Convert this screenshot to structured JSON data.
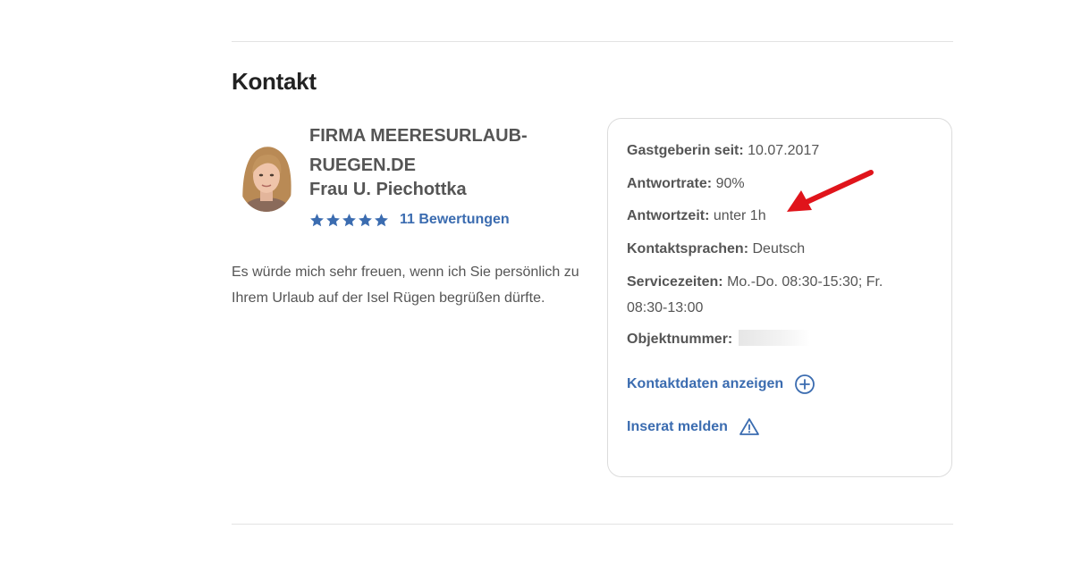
{
  "section": {
    "title": "Kontakt"
  },
  "host": {
    "company": "FIRMA MEERESURLAUB-RUEGEN.DE",
    "name": "Frau U. Piechottka",
    "rating_stars": 5,
    "reviews_link": "11 Bewertungen",
    "intro": "Es würde mich sehr freuen, wenn ich Sie persönlich zu Ihrem Urlaub auf der Isel Rügen begrüßen dürfte."
  },
  "facts": {
    "host_since_label": "Gastgeberin seit:",
    "host_since_value": "10.07.2017",
    "response_rate_label": "Antwortrate:",
    "response_rate_value": "90%",
    "response_time_label": "Antwortzeit:",
    "response_time_value": "unter 1h",
    "languages_label": "Kontaktsprachen:",
    "languages_value": "Deutsch",
    "service_label": "Servicezeiten:",
    "service_value": "Mo.-Do. 08:30-15:30; Fr. 08:30-13:00",
    "object_label": "Objektnummer:"
  },
  "actions": {
    "show_contact": "Kontaktdaten anzeigen",
    "report": "Inserat melden"
  },
  "colors": {
    "accent": "#3b6cb0",
    "annotation_arrow": "#e0141b",
    "text": "#555555",
    "heading": "#222222"
  },
  "icons": {
    "rating": "star-icon",
    "show_contact": "plus-circle-icon",
    "report": "warning-triangle-icon"
  }
}
